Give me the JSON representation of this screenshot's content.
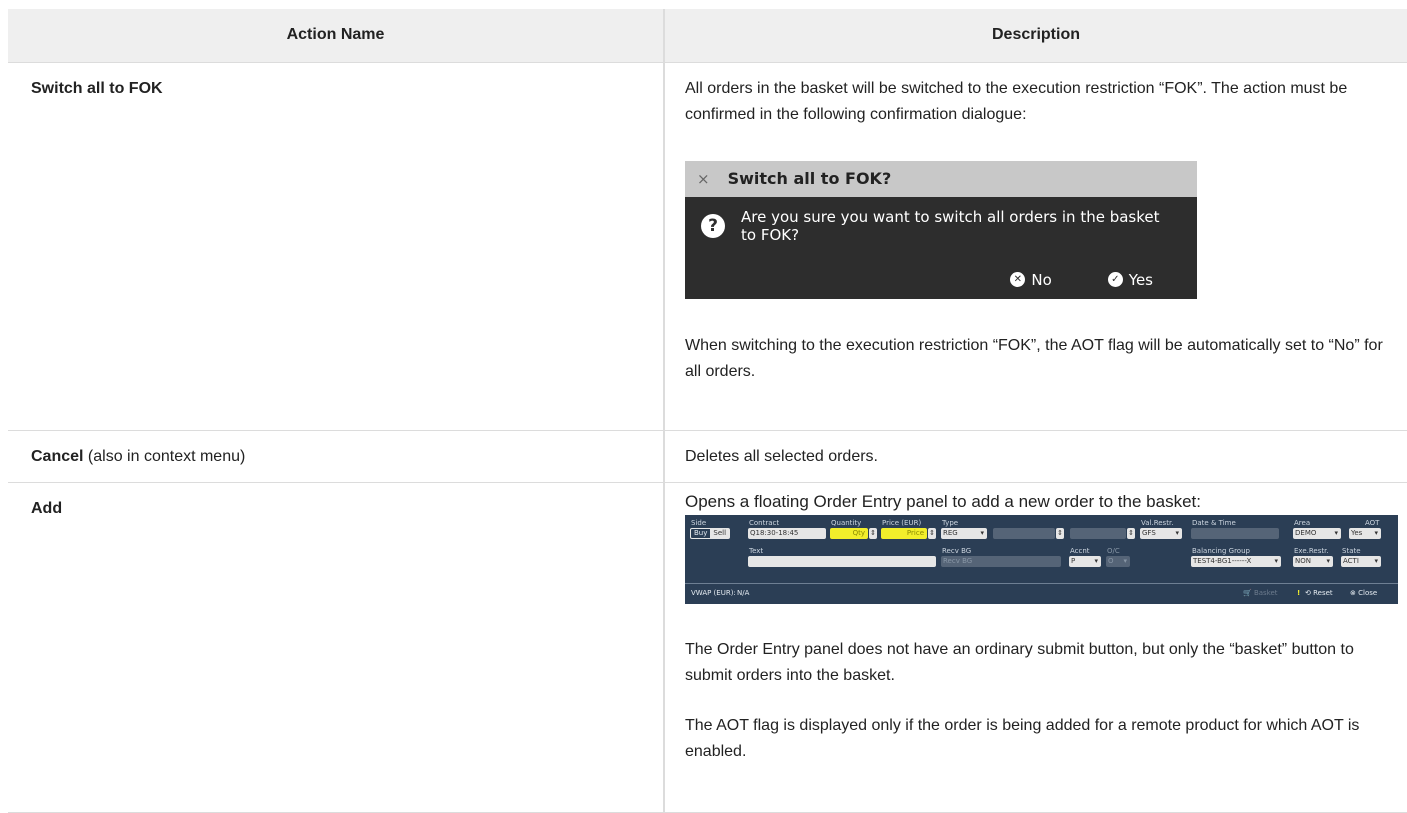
{
  "table": {
    "header_action": "Action Name",
    "header_description": "Description"
  },
  "rows": [
    {
      "name": "Switch all to FOK",
      "desc1": "All orders in the basket will be switched to the execution restriction “FOK”. The action must be confirmed in the following confirmation dialogue:",
      "dialog": {
        "title": "Switch all to FOK?",
        "close_glyph": "×",
        "question_glyph": "?",
        "message": "Are you sure you want to switch all orders in the basket to FOK?",
        "no_label": "No",
        "yes_label": "Yes"
      },
      "desc2": "When switching to the execution restriction “FOK”, the AOT flag will be automatically set to “No” for all orders."
    },
    {
      "name": "Cancel",
      "name_suffix": "(also in context menu)",
      "desc": "Deletes all selected orders."
    },
    {
      "name": "Add",
      "desc1": "Opens a floating Order Entry panel to add a new order to the basket:",
      "desc2": "The Order Entry panel does not have an ordinary submit button, but only the “basket” button to submit orders into the basket.",
      "desc3": "The AOT flag is displayed only if the order is being added for a remote product for which AOT is enabled."
    }
  ],
  "order_entry": {
    "side_label": "Side",
    "buy": "Buy",
    "sell": "Sell",
    "contract_label": "Contract",
    "contract_value": "Q18:30-18:45",
    "quantity_label": "Quantity",
    "quantity_placeholder": "Qty",
    "price_label": "Price (EUR)",
    "price_placeholder": "Price",
    "type_label": "Type",
    "type_value": "REG",
    "valrestr_label": "Val.Restr.",
    "valrestr_value": "GFS",
    "datetime_label": "Date & Time",
    "area_label": "Area",
    "area_value": "DEMO",
    "aot_label": "AOT",
    "aot_value": "Yes",
    "text_label": "Text",
    "recvbg_label": "Recv BG",
    "recvbg_placeholder": "Recv BG",
    "accnt_label": "Accnt",
    "accnt_value": "P",
    "oc_label": "O/C",
    "oc_value": "O",
    "balgroup_label": "Balancing Group",
    "balgroup_value": "TEST4-BG1------X",
    "exerestr_label": "Exe.Restr.",
    "exerestr_value": "NON",
    "state_label": "State",
    "state_value": "ACTI",
    "vwap_label": "VWAP (EUR):",
    "vwap_value": "N/A",
    "basket_label": "Basket",
    "warn_glyph": "!",
    "reset_label": "Reset",
    "close_label": "Close"
  }
}
